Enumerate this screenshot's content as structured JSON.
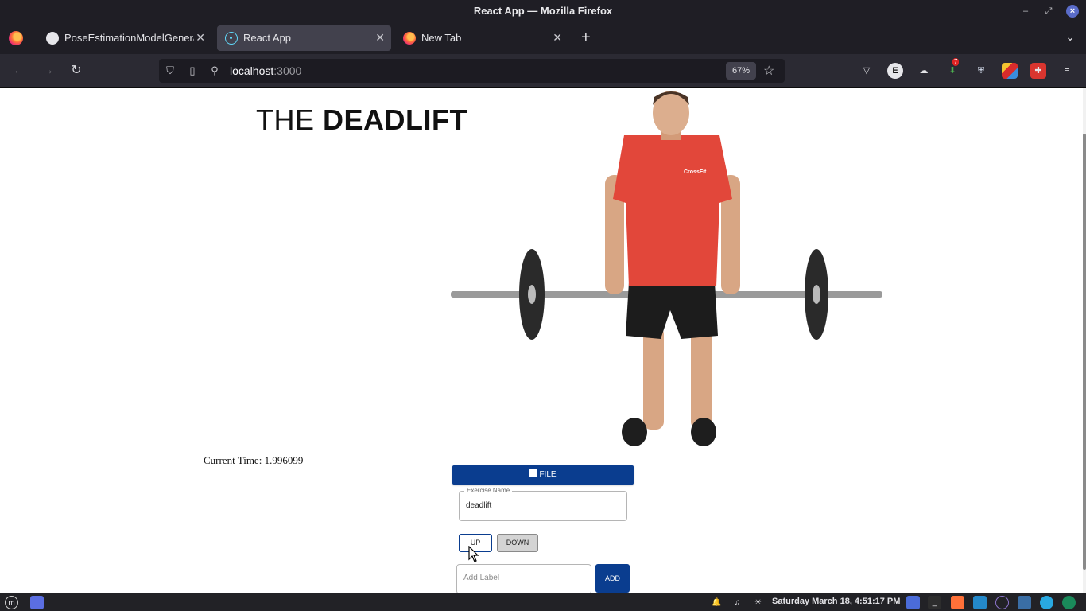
{
  "window": {
    "title": "React App — Mozilla Firefox"
  },
  "tabs": [
    {
      "label": "PoseEstimationModelGenerator",
      "icon": "github-icon"
    },
    {
      "label": "React App",
      "icon": "react-icon",
      "active": true
    },
    {
      "label": "New Tab",
      "icon": "firefox-icon"
    }
  ],
  "urlbar": {
    "host": "localhost",
    "port": ":3000",
    "zoom": "67%"
  },
  "toolbar": {
    "ext_badge": "7",
    "ext_e_label": "E"
  },
  "page": {
    "heading_light": "THE ",
    "heading_bold": "DEADLIFT",
    "current_time_label": "Current Time: 1.996099",
    "file_button": "FILE",
    "exercise_field": {
      "legend": "Exercise Name",
      "value": "deadlift"
    },
    "toggle_up": "UP",
    "toggle_down": "DOWN",
    "label_placeholder": "Add Label",
    "add_button": "ADD",
    "figure_alt": ""
  },
  "taskbar": {
    "clock": "Saturday March 18,  4:51:17 PM"
  },
  "colors": {
    "primary": "#0a3d8f",
    "shirt": "#e2473a"
  }
}
